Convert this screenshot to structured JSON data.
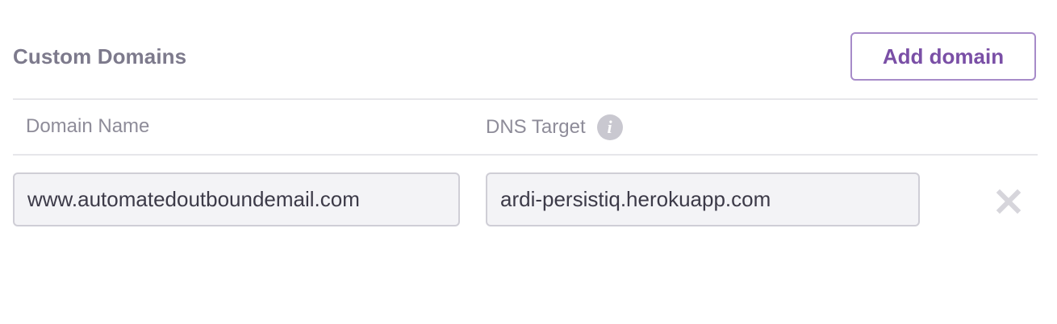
{
  "section": {
    "title": "Custom Domains",
    "add_button_label": "Add domain"
  },
  "table": {
    "columns": {
      "domain_name": "Domain Name",
      "dns_target": "DNS Target"
    },
    "info_icon": "info-icon",
    "rows": [
      {
        "domain": "www.automatedoutboundemail.com",
        "dns_target": "ardi-persistiq.herokuapp.com",
        "remove_icon": "close-icon"
      }
    ]
  },
  "colors": {
    "accent": "#7a4fa6",
    "accent_border": "#a78bc9",
    "muted_text": "#7d7a8c",
    "field_background": "#f3f3f6"
  }
}
